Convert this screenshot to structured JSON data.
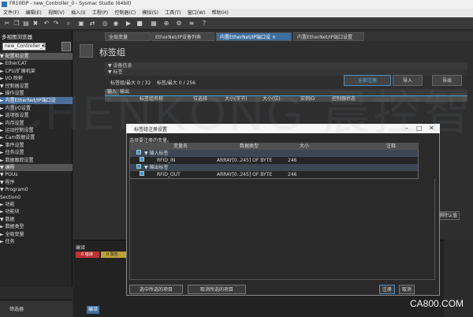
{
  "window": {
    "title": "FR10EIP - new_Controller_0 - Sysmac Studio (64bit)"
  },
  "menu": [
    "文件(F)",
    "编辑(E)",
    "视图(V)",
    "插入(I)",
    "工程(P)",
    "控制器(C)",
    "模拟(S)",
    "工具(T)",
    "窗口(W)",
    "帮助(H)"
  ],
  "left_pane": {
    "title": "多视图浏览器",
    "controller": "new_Controller_0",
    "tree": [
      {
        "label": "▼ 配置和设置",
        "style": "hdr"
      },
      {
        "label": "  ► EtherCAT",
        "style": ""
      },
      {
        "label": "  ► CPU/扩展机架",
        "style": ""
      },
      {
        "label": "  ► I/O 映射",
        "style": ""
      },
      {
        "label": "  ▼ 控制器设置",
        "style": ""
      },
      {
        "label": "     ► 操作设置",
        "style": ""
      },
      {
        "label": "     ► 内置EtherNet/IP端口设",
        "style": "sel"
      },
      {
        "label": "     ► 内置I/O设置",
        "style": ""
      },
      {
        "label": "     ► 选项板设置",
        "style": ""
      },
      {
        "label": "     ► 内存设置",
        "style": ""
      },
      {
        "label": "  ► 运动控制设置",
        "style": ""
      },
      {
        "label": "  ► Cam数据设置",
        "style": ""
      },
      {
        "label": "  ► 事件设置",
        "style": ""
      },
      {
        "label": "  ► 任务设置",
        "style": ""
      },
      {
        "label": "  ► 数据跟踪设置",
        "style": ""
      },
      {
        "label": "▼ 编程",
        "style": "hdr"
      },
      {
        "label": "  ▼ POUs",
        "style": ""
      },
      {
        "label": "     ▼ 程序",
        "style": ""
      },
      {
        "label": "        ▼ Program0",
        "style": ""
      },
      {
        "label": "           Section0",
        "style": ""
      },
      {
        "label": "     ► 功能",
        "style": ""
      },
      {
        "label": "     ► 功能块",
        "style": ""
      },
      {
        "label": "  ▼ 数据",
        "style": ""
      },
      {
        "label": "     ► 数据类型",
        "style": ""
      },
      {
        "label": "     ► 全局变量",
        "style": ""
      },
      {
        "label": "  ► 任务",
        "style": ""
      }
    ],
    "filter_label": "筛选器"
  },
  "tabs": [
    "全局变量",
    "EtherNet/IP设备列表",
    "内置EtherNet/IP端口设 ×",
    "内置EtherNet/IP端口设置"
  ],
  "main": {
    "title": "标签组",
    "device_info": "▼ 设备信息",
    "tag_section": "▼ 标签",
    "tag_count_label": "标签组/最大",
    "tag_count": "0",
    "tag_max": "32",
    "tag_label2": "标签/最大",
    "tag2_count": "0",
    "tag2_max": "256",
    "btn_register_all": "全部注册",
    "btn_import": "导入",
    "btn_export": "导出",
    "io_tabs": [
      "输入",
      "输出"
    ],
    "grid_cols": [
      "标签组名称",
      "位选择",
      "大小(字节)",
      "大小(位)",
      "实例ID",
      "控制器状态"
    ],
    "right_btn": "删除认值"
  },
  "dialog": {
    "title": "标签组注册设置",
    "message": "选择要注册的变量。",
    "columns": [
      "变量名",
      "数据类型",
      "大小",
      "注释"
    ],
    "rows": [
      {
        "name": "▼ 输入标签",
        "type": "",
        "size": "",
        "group": true
      },
      {
        "name": "RFID_IN",
        "type": "ARRAY[0..245] OF BYTE",
        "size": "246",
        "group": false
      },
      {
        "name": "▼ 输出标签",
        "type": "",
        "size": "",
        "group": true
      },
      {
        "name": "RFID_OUT",
        "type": "ARRAY[0..245] OF BYTE",
        "size": "246",
        "group": false
      }
    ],
    "btn_select_all": "选中所选的项目",
    "btn_deselect_all": "取消所选的项目",
    "btn_register": "注册",
    "btn_cancel": "取消"
  },
  "bottom": {
    "title": "编译",
    "errors": "0 错误",
    "warnings": "0 警告",
    "tab": "编译"
  },
  "watermark": "CA800.COM",
  "ghost_text": "CHENKONG 晨控智能"
}
